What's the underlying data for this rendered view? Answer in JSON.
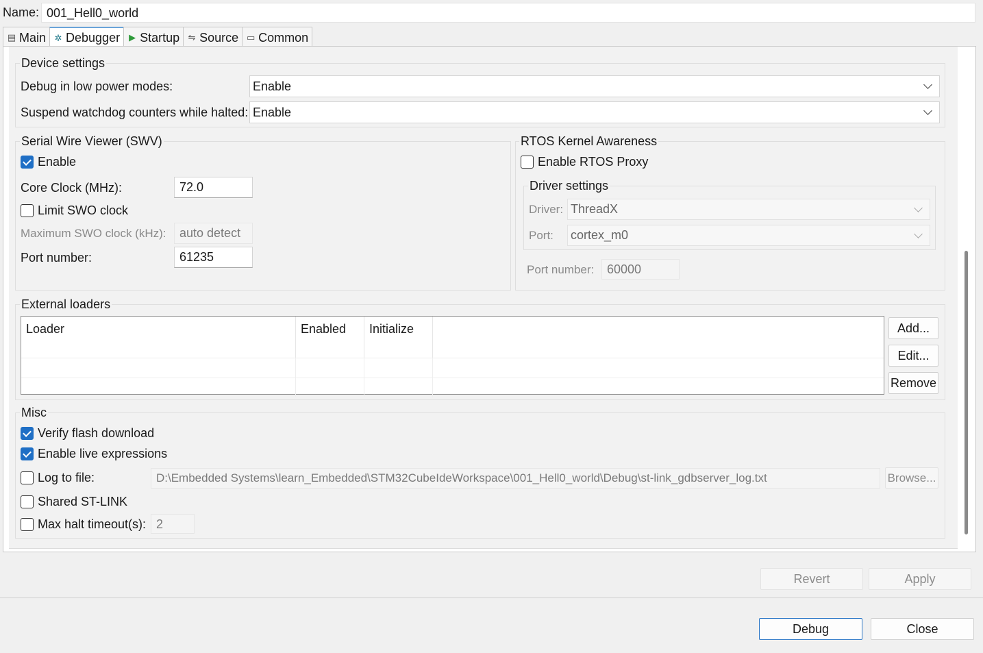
{
  "name": {
    "label": "Name:",
    "value": "001_Hell0_world"
  },
  "tabs": [
    {
      "label": "Main",
      "icon": "document-icon"
    },
    {
      "label": "Debugger",
      "icon": "bug-icon"
    },
    {
      "label": "Startup",
      "icon": "run-icon"
    },
    {
      "label": "Source",
      "icon": "source-icon"
    },
    {
      "label": "Common",
      "icon": "common-icon"
    }
  ],
  "device": {
    "title": "Device settings",
    "low_power_label": "Debug in low power modes:",
    "low_power_value": "Enable",
    "watchdog_label": "Suspend watchdog counters while halted:",
    "watchdog_value": "Enable"
  },
  "swv": {
    "title": "Serial Wire Viewer (SWV)",
    "enable_label": "Enable",
    "enable_checked": true,
    "core_clock_label": "Core Clock (MHz):",
    "core_clock_value": "72.0",
    "limit_swo_label": "Limit SWO clock",
    "limit_swo_checked": false,
    "max_swo_label": "Maximum SWO clock (kHz):",
    "max_swo_value": "auto detect",
    "port_label": "Port number:",
    "port_value": "61235"
  },
  "rtos": {
    "title": "RTOS Kernel Awareness",
    "enable_label": "Enable RTOS Proxy",
    "enable_checked": false,
    "driver_settings_title": "Driver settings",
    "driver_label": "Driver:",
    "driver_value": "ThreadX",
    "port_label": "Port:",
    "port_value": "cortex_m0",
    "port_number_label": "Port number:",
    "port_number_value": "60000"
  },
  "loaders": {
    "title": "External loaders",
    "columns": [
      "Loader",
      "Enabled",
      "Initialize"
    ],
    "add": "Add...",
    "edit": "Edit...",
    "remove": "Remove"
  },
  "misc": {
    "title": "Misc",
    "verify_label": "Verify flash download",
    "verify_checked": true,
    "live_label": "Enable live expressions",
    "live_checked": true,
    "log_label": "Log to file:",
    "log_checked": false,
    "log_path": "D:\\Embedded Systems\\learn_Embedded\\STM32CubeIdeWorkspace\\001_Hell0_world\\Debug\\st-link_gdbserver_log.txt",
    "browse": "Browse...",
    "shared_label": "Shared ST-LINK",
    "shared_checked": false,
    "halt_label": "Max halt timeout(s):",
    "halt_checked": false,
    "halt_value": "2"
  },
  "buttons": {
    "revert": "Revert",
    "apply": "Apply",
    "debug": "Debug",
    "close": "Close"
  }
}
